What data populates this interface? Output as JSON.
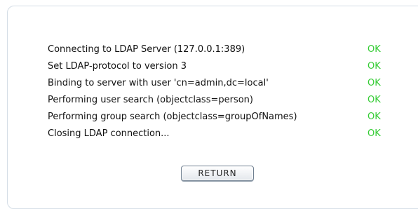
{
  "steps": [
    {
      "message": "Connecting to LDAP Server (127.0.0.1:389)",
      "status": "OK"
    },
    {
      "message": "Set LDAP-protocol to version 3",
      "status": "OK"
    },
    {
      "message": "Binding to server with user 'cn=admin,dc=local'",
      "status": "OK"
    },
    {
      "message": "Performing user search (objectclass=person)",
      "status": "OK"
    },
    {
      "message": "Performing group search (objectclass=groupOfNames)",
      "status": "OK"
    },
    {
      "message": "Closing LDAP connection...",
      "status": "OK"
    }
  ],
  "return_button": {
    "label": "RETURN"
  },
  "colors": {
    "status_ok": "#33cc33",
    "panel_border": "#d4dde6"
  }
}
